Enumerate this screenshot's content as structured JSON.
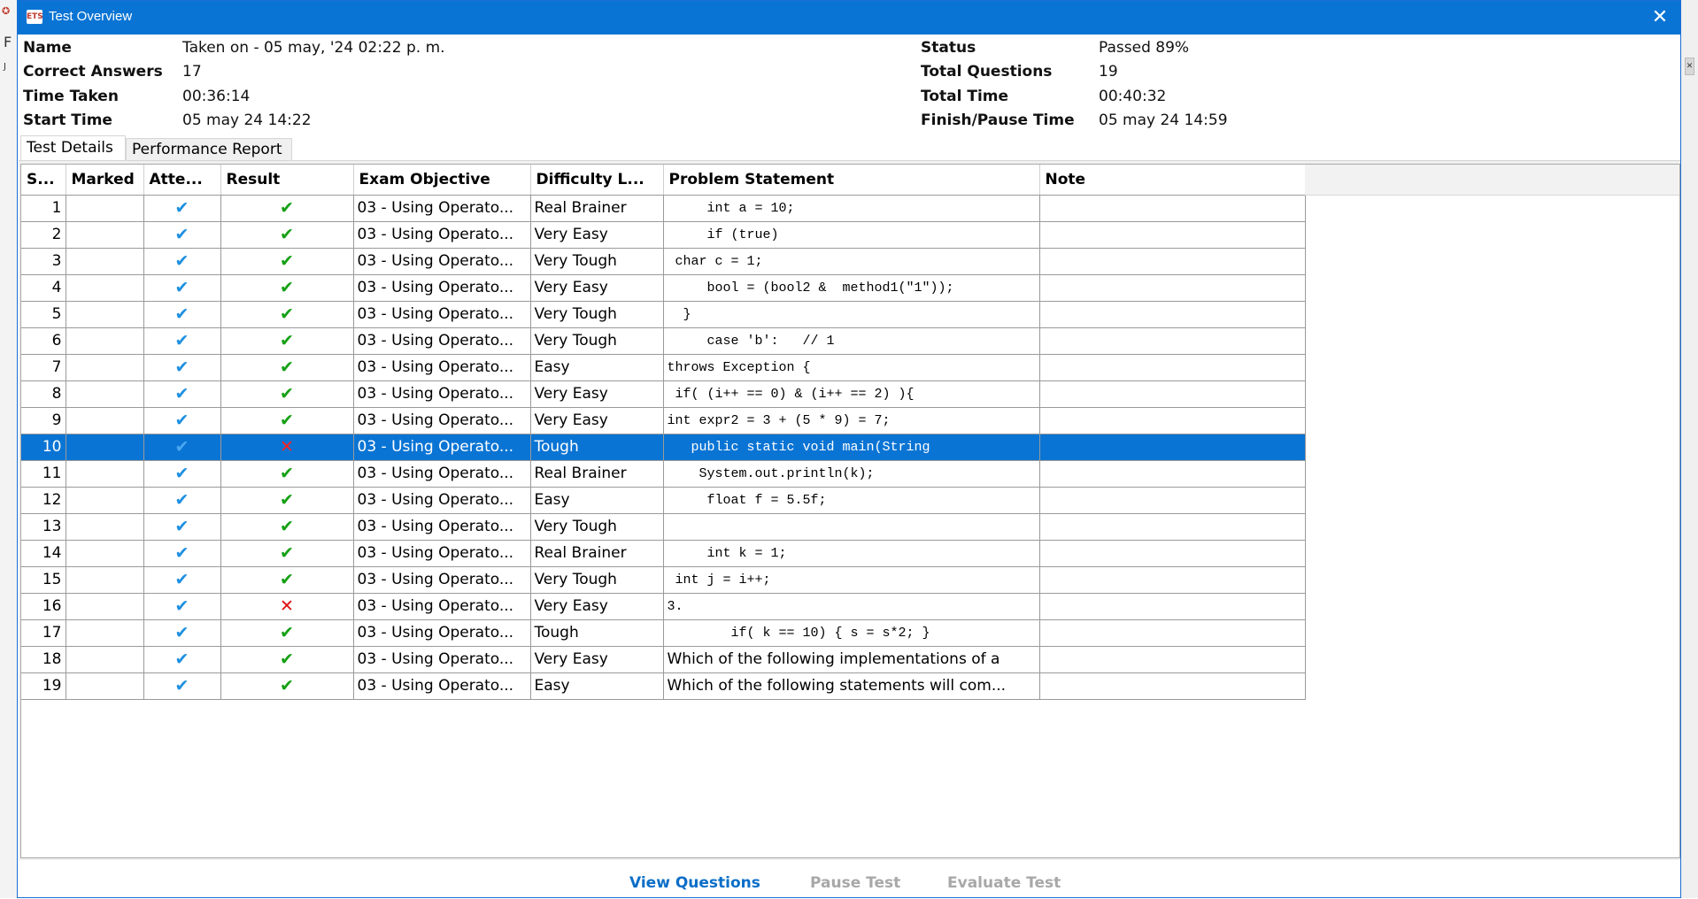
{
  "window": {
    "title": "Test Overview"
  },
  "info": {
    "name_label": "Name",
    "name_value": "Taken on - 05 may, '24 02:22 p. m.",
    "correct_label": "Correct Answers",
    "correct_value": "17",
    "time_taken_label": "Time Taken",
    "time_taken_value": "00:36:14",
    "start_label": "Start Time",
    "start_value": "05 may 24 14:22",
    "status_label": "Status",
    "status_value": "Passed 89%",
    "total_q_label": "Total Questions",
    "total_q_value": "19",
    "total_time_label": "Total Time",
    "total_time_value": "00:40:32",
    "finish_label": "Finish/Pause Time",
    "finish_value": "05 may 24 14:59"
  },
  "tabs": [
    {
      "label": "Test Details",
      "active": true
    },
    {
      "label": "Performance Report",
      "active": false
    }
  ],
  "table": {
    "columns": [
      "S...",
      "Marked",
      "Atte...",
      "Result",
      "Exam Objective",
      "Difficulty L...",
      "Problem Statement",
      "Note"
    ],
    "rows": [
      {
        "n": "1",
        "attempted": "✔",
        "result": "correct",
        "objective": "03 - Using Operato...",
        "difficulty": "Real Brainer",
        "statement": "     int a = 10;"
      },
      {
        "n": "2",
        "attempted": "✔",
        "result": "correct",
        "objective": "03 - Using Operato...",
        "difficulty": "Very Easy",
        "statement": "     if (true)"
      },
      {
        "n": "3",
        "attempted": "✔",
        "result": "correct",
        "objective": "03 - Using Operato...",
        "difficulty": "Very Tough",
        "statement": " char c = 1;"
      },
      {
        "n": "4",
        "attempted": "✔",
        "result": "correct",
        "objective": "03 - Using Operato...",
        "difficulty": "Very Easy",
        "statement": "     bool = (bool2 &  method1(\"1\"));"
      },
      {
        "n": "5",
        "attempted": "✔",
        "result": "correct",
        "objective": "03 - Using Operato...",
        "difficulty": "Very Tough",
        "statement": "  }"
      },
      {
        "n": "6",
        "attempted": "✔",
        "result": "correct",
        "objective": "03 - Using Operato...",
        "difficulty": "Very Tough",
        "statement": "     case 'b':   // 1"
      },
      {
        "n": "7",
        "attempted": "✔",
        "result": "correct",
        "objective": "03 - Using Operato...",
        "difficulty": "Easy",
        "statement": "throws Exception {"
      },
      {
        "n": "8",
        "attempted": "✔",
        "result": "correct",
        "objective": "03 - Using Operato...",
        "difficulty": "Very Easy",
        "statement": " if( (i++ == 0) & (i++ == 2) ){"
      },
      {
        "n": "9",
        "attempted": "✔",
        "result": "correct",
        "objective": "03 - Using Operato...",
        "difficulty": "Very Easy",
        "statement": "int expr2 = 3 + (5 * 9) = 7;"
      },
      {
        "n": "10",
        "attempted": "✔",
        "result": "wrong",
        "objective": "03 - Using Operato...",
        "difficulty": "Tough",
        "statement": "   public static void main(String",
        "selected": true
      },
      {
        "n": "11",
        "attempted": "✔",
        "result": "correct",
        "objective": "03 - Using Operato...",
        "difficulty": "Real Brainer",
        "statement": "    System.out.println(k);"
      },
      {
        "n": "12",
        "attempted": "✔",
        "result": "correct",
        "objective": "03 - Using Operato...",
        "difficulty": "Easy",
        "statement": "     float f = 5.5f;"
      },
      {
        "n": "13",
        "attempted": "✔",
        "result": "correct",
        "objective": "03 - Using Operato...",
        "difficulty": "Very Tough",
        "statement": ""
      },
      {
        "n": "14",
        "attempted": "✔",
        "result": "correct",
        "objective": "03 - Using Operato...",
        "difficulty": "Real Brainer",
        "statement": "     int k = 1;"
      },
      {
        "n": "15",
        "attempted": "✔",
        "result": "correct",
        "objective": "03 - Using Operato...",
        "difficulty": "Very Tough",
        "statement": " int j = i++;"
      },
      {
        "n": "16",
        "attempted": "✔",
        "result": "wrong",
        "objective": "03 - Using Operato...",
        "difficulty": "Very Easy",
        "statement": "3."
      },
      {
        "n": "17",
        "attempted": "✔",
        "result": "correct",
        "objective": "03 - Using Operato...",
        "difficulty": "Tough",
        "statement": "        if( k == 10) { s = s*2; }"
      },
      {
        "n": "18",
        "attempted": "✔",
        "result": "correct",
        "objective": "03 - Using Operato...",
        "difficulty": "Very Easy",
        "statement": "Which of the following implementations of a",
        "prose": true
      },
      {
        "n": "19",
        "attempted": "✔",
        "result": "correct",
        "objective": "03 - Using Operato...",
        "difficulty": "Easy",
        "statement": "Which of the following statements will com...",
        "prose": true
      }
    ]
  },
  "buttons": {
    "view_questions": "View Questions",
    "pause_test": "Pause Test",
    "evaluate_test": "Evaluate Test"
  },
  "glyphs": {
    "check": "✔",
    "cross": "✕",
    "close": "✕"
  },
  "colors": {
    "title_bar": "#0a74d4",
    "selection": "#0a74d4",
    "correct": "#15a015",
    "wrong": "#e01010",
    "attempted": "#1e90e0",
    "link": "#0a6ec8"
  }
}
